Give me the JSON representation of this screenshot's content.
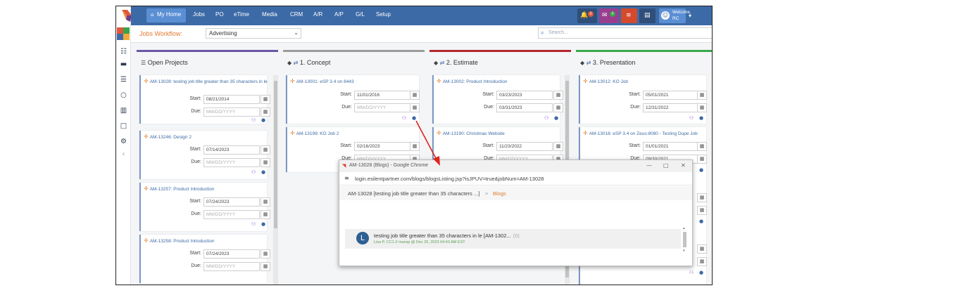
{
  "nav": {
    "home": "My Home",
    "items": [
      "Jobs",
      "PO",
      "eTime",
      "Media",
      "CRM",
      "A/R",
      "A/P",
      "G/L",
      "Setup"
    ],
    "welcome": "Welcome,",
    "user_initials": "RC",
    "badges": {
      "notifications": "0",
      "messages": "0"
    }
  },
  "workflow": {
    "label": "Jobs Workflow:",
    "selected": "Advertising",
    "search_placeholder": "Search..."
  },
  "columns": [
    {
      "title": "Open Projects",
      "color": "#6b57a8",
      "cards": [
        {
          "title": "AM-13028: testing job title greater than 35 characters in le",
          "start": "08/21/2014",
          "due": "MM/DD/YYYY"
        },
        {
          "title": "AM-13246: Design 2",
          "start": "07/14/2023",
          "due": "MM/DD/YYYY"
        },
        {
          "title": "AM-13257: Product Introduction",
          "start": "07/24/2023",
          "due": "MM/DD/YYYY"
        },
        {
          "title": "AM-13258: Product Introduction",
          "start": "07/24/2023",
          "due": "MM/DD/YYYY"
        }
      ]
    },
    {
      "title": "1. Concept",
      "color": "#9c9c9c",
      "cards": [
        {
          "title": "AM-13001: eSP 3.4 on 8443",
          "start": "11/01/2016",
          "due": "MM/DD/YYYY"
        },
        {
          "title": "AM-13199: KO Job 2",
          "start": "02/16/2023",
          "due": "MM/DD/YYYY"
        }
      ]
    },
    {
      "title": "2. Estimate",
      "color": "#b3282d",
      "cards": [
        {
          "title": "AM-13002: Product Introduction",
          "start": "03/23/2023",
          "due": "03/31/2023"
        },
        {
          "title": "AM-13190: Christmas Website",
          "start": "11/23/2022",
          "due": "MM/DD/YYYY"
        }
      ]
    },
    {
      "title": "3. Presentation",
      "color": "#39a94a",
      "cards": [
        {
          "title": "AM-13012: KO Job",
          "start": "05/01/2021",
          "due": "12/31/2022"
        },
        {
          "title": "AM-13018: eSP 3.4 on Zeus:8080 - Testing Dupe Job",
          "start": "01/01/2021",
          "due": "09/30/2021"
        }
      ]
    }
  ],
  "labels": {
    "start": "Start:",
    "due": "Due:"
  },
  "popup": {
    "window_title": "AM-13028 (Blogs) - Google Chrome",
    "url": "login.esilentpartner.com/blogs/blogsListing.jsp?isJPUV=true&jobNum=AM-13028",
    "breadcrumb_job": "AM-13028 [testing job title greater than 35 characters ...]",
    "breadcrumb_sep": ">",
    "breadcrumb_current": "Blogs",
    "entry": {
      "avatar": "L",
      "title": "testing job title greater than 35 characters in le [AM-1302...",
      "count": "(0)",
      "meta": "Lisa P, CC1-2 msesp @ Dec 20, 2023 04:43 AM EST"
    },
    "controls": {
      "minimize": "—",
      "maximize": "□",
      "close": "✕"
    }
  }
}
